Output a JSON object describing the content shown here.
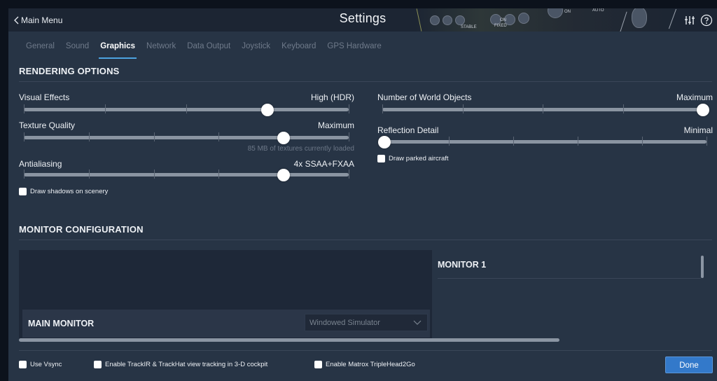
{
  "titlebar": {
    "back_label": "Main Menu",
    "title": "Settings",
    "icons": [
      "sliders-icon",
      "help-icon"
    ],
    "panel_text": [
      "ON",
      "STABLE",
      "FIXED",
      "AUTO"
    ]
  },
  "tabs": [
    {
      "label": "General",
      "active": false
    },
    {
      "label": "Sound",
      "active": false
    },
    {
      "label": "Graphics",
      "active": true
    },
    {
      "label": "Network",
      "active": false
    },
    {
      "label": "Data Output",
      "active": false
    },
    {
      "label": "Joystick",
      "active": false
    },
    {
      "label": "Keyboard",
      "active": false
    },
    {
      "label": "GPS Hardware",
      "active": false
    }
  ],
  "rendering": {
    "heading": "RENDERING OPTIONS",
    "visual_effects": {
      "label": "Visual Effects",
      "value": "High (HDR)",
      "level": 0.75
    },
    "texture_quality": {
      "label": "Texture Quality",
      "value": "Maximum",
      "level": 0.8,
      "note": "85 MB of textures currently loaded"
    },
    "antialiasing": {
      "label": "Antialiasing",
      "value": "4x SSAA+FXAA",
      "level": 0.8
    },
    "world_objects": {
      "label": "Number of World Objects",
      "value": "Maximum",
      "level": 1.0
    },
    "reflection_detail": {
      "label": "Reflection Detail",
      "value": "Minimal",
      "level": 0.0
    },
    "draw_shadows": {
      "label": "Draw shadows on scenery",
      "checked": false
    },
    "draw_parked": {
      "label": "Draw parked aircraft",
      "checked": false
    }
  },
  "monitor": {
    "heading": "MONITOR CONFIGURATION",
    "main_monitor_title": "MAIN MONITOR",
    "main_monitor_mode": "Windowed Simulator",
    "monitor1_title": "MONITOR 1"
  },
  "footer": {
    "use_vsync": "Use Vsync",
    "trackir": "Enable TrackIR & TrackHat view tracking in 3-D cockpit",
    "matrox": "Enable Matrox TripleHead2Go",
    "done_label": "Done"
  },
  "colors": {
    "accent": "#3379ca",
    "tab_underline": "#4da3e0",
    "panel": "#273445",
    "titlebar": "#1c2533"
  }
}
